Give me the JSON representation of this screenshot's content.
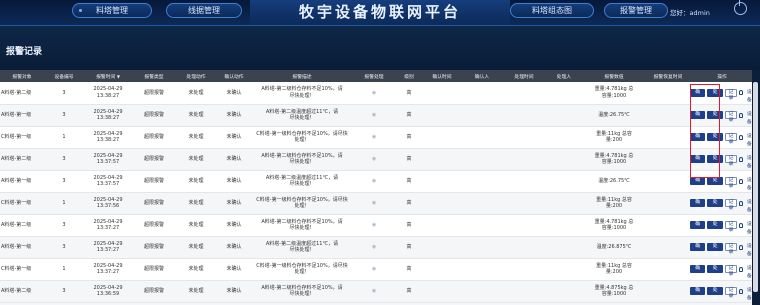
{
  "header": {
    "title": "牧宇设备物联网平台",
    "nav_left": [
      "料塔管理",
      "线据管理"
    ],
    "nav_right": [
      "料塔组态图",
      "报警管理"
    ],
    "user_label": "您好：admin"
  },
  "page": {
    "title": "报警记录"
  },
  "table": {
    "columns": [
      "报警对象",
      "设备编号",
      "报警时间",
      "报警类型",
      "处理动作",
      "确认动作",
      "报警描述",
      "报警处理",
      "级别",
      "确认时间",
      "确认人",
      "处理时间",
      "处理人",
      "报警数值",
      "报警恢复时间",
      "操作"
    ],
    "sort_indicator": "▼",
    "ops": {
      "confirm": "确 认",
      "handle": "处 理",
      "record": "记录",
      "device": "设 备"
    },
    "rows": [
      {
        "object": "A料塔-第二级",
        "device": "3",
        "date": "2025-04-29",
        "time": "13:38:27",
        "type": "超限报警",
        "action": "未处理",
        "confirm": "未确认",
        "desc1": "A料塔-第二级料仓存料不足10%，请",
        "desc2": "尽快处理！",
        "level": "高",
        "value1": "重量:4.781kg 总",
        "value2": "容量:1000"
      },
      {
        "object": "A料塔-第一级",
        "device": "3",
        "date": "2025-04-29",
        "time": "13:38:27",
        "type": "超限报警",
        "action": "未处理",
        "confirm": "未确认",
        "desc1": "A料塔-第二级温度超过11℃，请",
        "desc2": "尽快处理！",
        "level": "高",
        "value1": "温度:26.75℃",
        "value2": ""
      },
      {
        "object": "C料塔-第一级",
        "device": "1",
        "date": "2025-04-29",
        "time": "13:38:27",
        "type": "超限报警",
        "action": "未处理",
        "confirm": "未确认",
        "desc1": "C料塔-第一级料仓存料不足10%，请尽快",
        "desc2": "处理！",
        "level": "高",
        "value1": "重量:11kg 总容",
        "value2": "量:200"
      },
      {
        "object": "A料塔-第二级",
        "device": "3",
        "date": "2025-04-29",
        "time": "13:37:57",
        "type": "超限报警",
        "action": "未处理",
        "confirm": "未确认",
        "desc1": "A料塔-第二级料仓存料不足10%，请",
        "desc2": "尽快处理！",
        "level": "高",
        "value1": "重量:4.781kg 总",
        "value2": "容量:1000"
      },
      {
        "object": "A料塔-第一级",
        "device": "3",
        "date": "2025-04-29",
        "time": "13:37:57",
        "type": "超限报警",
        "action": "未处理",
        "confirm": "未确认",
        "desc1": "A料塔-第二级温度超过11℃，请",
        "desc2": "尽快处理！",
        "level": "高",
        "value1": "温度:26.75℃",
        "value2": ""
      },
      {
        "object": "C料塔-第一级",
        "device": "1",
        "date": "2025-04-29",
        "time": "13:37:56",
        "type": "超限报警",
        "action": "未处理",
        "confirm": "未确认",
        "desc1": "C料塔-第一级料仓存料不足10%，请尽快",
        "desc2": "处理！",
        "level": "高",
        "value1": "重量:11kg 总容",
        "value2": "量:200"
      },
      {
        "object": "A料塔-第二级",
        "device": "3",
        "date": "2025-04-29",
        "time": "13:37:27",
        "type": "超限报警",
        "action": "未处理",
        "confirm": "未确认",
        "desc1": "A料塔-第二级料仓存料不足10%，请",
        "desc2": "尽快处理！",
        "level": "高",
        "value1": "重量:4.781kg 总",
        "value2": "容量:1000"
      },
      {
        "object": "A料塔-第一级",
        "device": "3",
        "date": "2025-04-29",
        "time": "13:37:27",
        "type": "超限报警",
        "action": "未处理",
        "confirm": "未确认",
        "desc1": "A料塔-第二级温度超过11℃，请",
        "desc2": "尽快处理！",
        "level": "高",
        "value1": "温度:26.875℃",
        "value2": ""
      },
      {
        "object": "C料塔-第一级",
        "device": "1",
        "date": "2025-04-29",
        "time": "13:37:27",
        "type": "超限报警",
        "action": "未处理",
        "confirm": "未确认",
        "desc1": "C料塔-第一级料仓存料不足10%，请尽快",
        "desc2": "处理！",
        "level": "高",
        "value1": "重量:11kg 总容",
        "value2": "量:200"
      },
      {
        "object": "A料塔-第二级",
        "device": "3",
        "date": "2025-04-29",
        "time": "13:36:59",
        "type": "超限报警",
        "action": "未处理",
        "confirm": "未确认",
        "desc1": "A料塔-第二级料仓存料不足10%，请",
        "desc2": "尽快处理！",
        "level": "高",
        "value1": "重量:4.875kg 总",
        "value2": "容量:1000"
      }
    ]
  }
}
